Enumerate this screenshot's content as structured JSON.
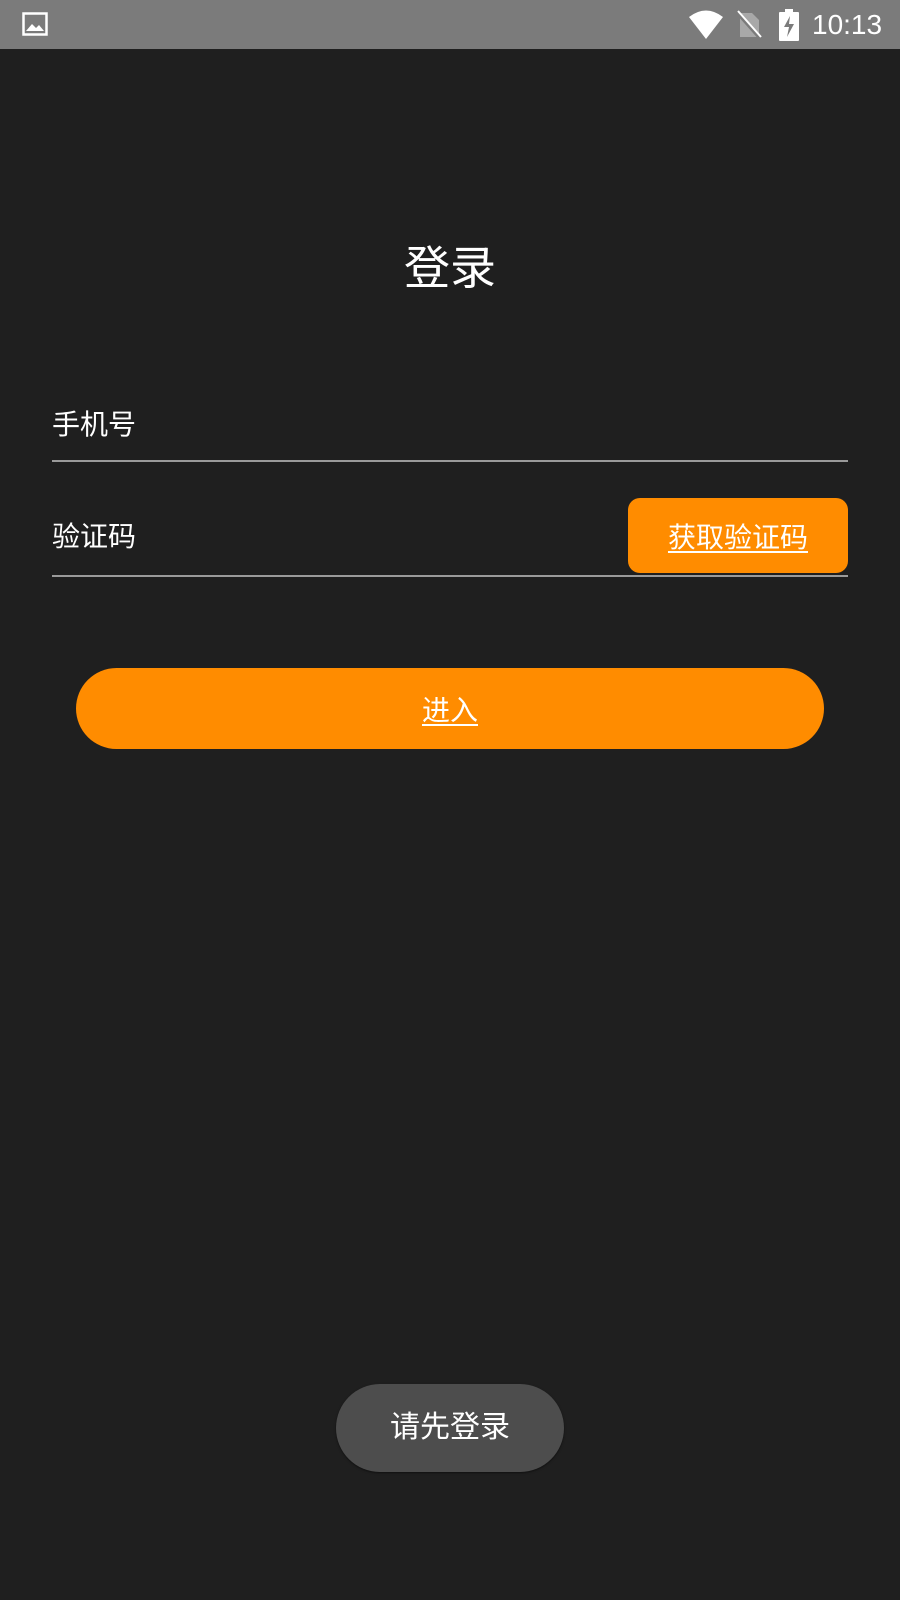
{
  "status_bar": {
    "time": "10:13",
    "icons": [
      "gallery-icon",
      "wifi-icon",
      "no-sim-icon",
      "battery-charging-icon"
    ]
  },
  "login": {
    "title": "登录",
    "phone_placeholder": "手机号",
    "code_placeholder": "验证码",
    "get_code_label": "获取验证码",
    "enter_label": "进入"
  },
  "toast": {
    "message": "请先登录"
  },
  "colors": {
    "background": "#1f1f1f",
    "accent": "#ff8c00",
    "status_bar": "#7b7b7b",
    "toast": "#4d4d4d"
  }
}
